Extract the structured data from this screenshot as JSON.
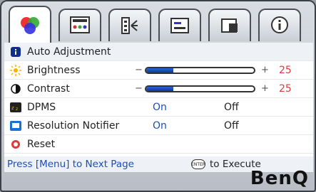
{
  "tabs": [
    {
      "name": "picture-tab"
    },
    {
      "name": "display-tab"
    },
    {
      "name": "audio-tab"
    },
    {
      "name": "setup-tab"
    },
    {
      "name": "input-tab"
    },
    {
      "name": "information-tab"
    }
  ],
  "menu": {
    "auto_adjustment": "Auto Adjustment",
    "brightness": {
      "label": "Brightness",
      "minus": "−",
      "plus": "+",
      "value": "25",
      "level": 0.25
    },
    "contrast": {
      "label": "Contrast",
      "minus": "−",
      "plus": "+",
      "value": "25",
      "level": 0.25
    },
    "dpms": {
      "label": "DPMS",
      "on": "On",
      "off": "Off"
    },
    "resolution_notifier": {
      "label": "Resolution Notifier",
      "on": "On",
      "off": "Off"
    },
    "reset": "Reset"
  },
  "footer": {
    "hint": "Press [Menu] to Next Page",
    "enter_key": "ENTER",
    "execute": "to Execute"
  },
  "brand": "BenQ",
  "colors": {
    "accent": "#1a4fb8",
    "value": "#e23a3a"
  }
}
